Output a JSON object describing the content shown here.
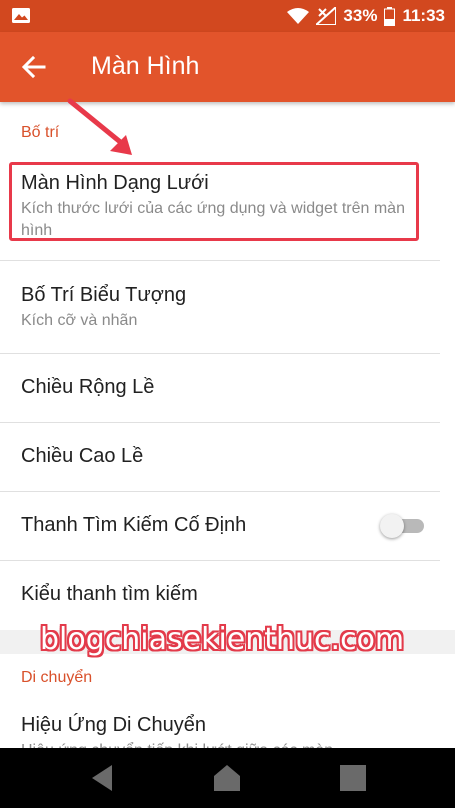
{
  "status_bar": {
    "battery_percent": "33%",
    "time": "11:33",
    "icons": [
      "image-notification-icon",
      "wifi-icon",
      "no-signal-icon",
      "battery-icon"
    ]
  },
  "app_bar": {
    "title": "Màn Hình",
    "back_icon": "arrow-back-icon",
    "background": "#e2542b"
  },
  "sections": {
    "layout_header": "Bố trí",
    "movement_header": "Di chuyển"
  },
  "preferences": {
    "grid": {
      "title": "Màn Hình Dạng Lưới",
      "summary": "Kích thước lưới của các ứng dụng và widget trên màn hình"
    },
    "icon_layout": {
      "title": "Bố Trí Biểu Tượng",
      "summary": "Kích cỡ và nhãn"
    },
    "margin_width": {
      "title": "Chiều Rộng Lề"
    },
    "margin_height": {
      "title": "Chiều Cao Lề"
    },
    "fixed_search": {
      "title": "Thanh Tìm Kiếm Cố Định",
      "enabled": false
    },
    "search_style": {
      "title": "Kiểu thanh tìm kiếm"
    },
    "move_effect": {
      "title": "Hiệu Ứng Di Chuyển",
      "summary": "Hiệu ứng chuyển tiếp khi lướt giữa các màn"
    }
  },
  "watermark": "blogchiasekienthuc.com",
  "nav_bar": {
    "icons": [
      "back-triangle-icon",
      "home-icon",
      "recents-icon"
    ]
  },
  "colors": {
    "accent": "#d9512b",
    "highlight": "#e8394a"
  }
}
